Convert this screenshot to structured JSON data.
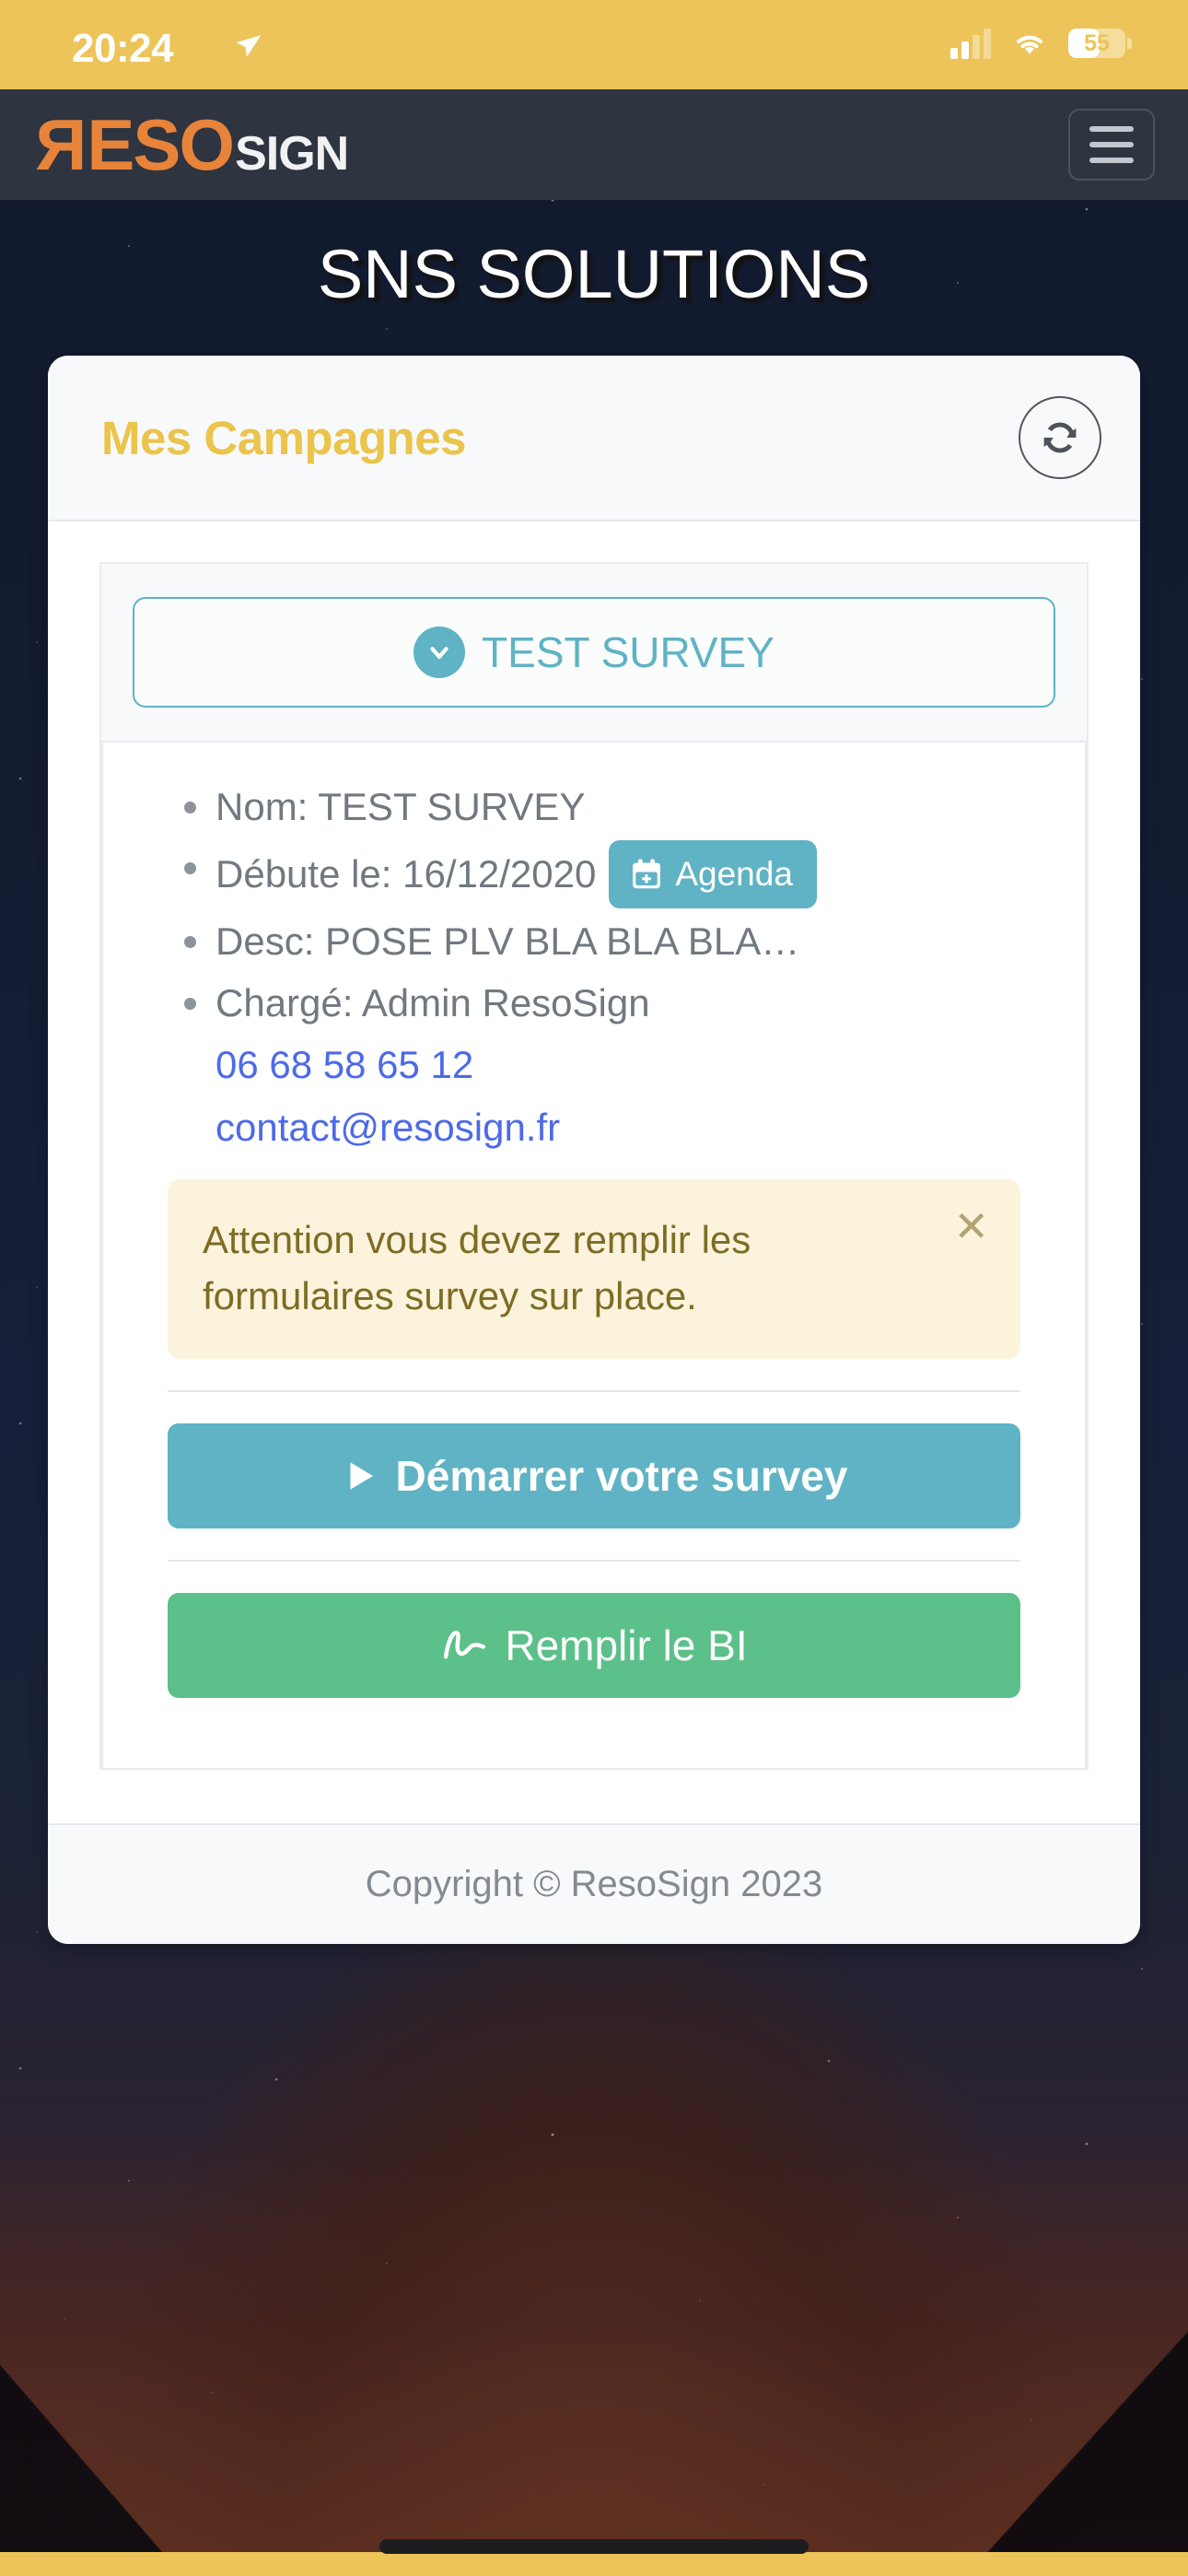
{
  "status_bar": {
    "time": "20:24",
    "battery_percent": "55",
    "battery_level": 55,
    "icons": [
      "location-arrow-icon",
      "cellular-signal-icon",
      "wifi-icon",
      "battery-icon"
    ],
    "background_color": "#ecc459"
  },
  "navbar": {
    "brand_primary": "RESO",
    "brand_secondary": "SIGN",
    "brand_primary_color": "#e8833a",
    "brand_secondary_color": "#f2f2f2",
    "background_color": "#2e3440",
    "menu_icon": "hamburger-menu-icon"
  },
  "page": {
    "title": "SNS SOLUTIONS"
  },
  "card": {
    "header_title": "Mes Campagnes",
    "header_title_color": "#ebc44c",
    "refresh_icon": "refresh-sync-icon",
    "footer_text": "Copyright © ResoSign 2023"
  },
  "accordion": {
    "toggle_label": "TEST SURVEY",
    "toggle_icon": "chevron-down-circle-icon",
    "accent_color": "#5fb3c4",
    "expanded": true
  },
  "details": {
    "nom_label": "Nom:",
    "nom_value": "TEST SURVEY",
    "nom_line": "Nom: TEST SURVEY",
    "debute_line": "Débute le: 16/12/2020",
    "debute_label": "Débute le:",
    "debute_value": "16/12/2020",
    "desc_line": "Desc: POSE PLV BLA BLA BLA…",
    "desc_label": "Desc:",
    "desc_value": "POSE PLV BLA BLA BLA…",
    "charge_line": "Chargé: Admin ResoSign",
    "charge_label": "Chargé:",
    "charge_value": "Admin ResoSign",
    "phone": "06 68 58 65 12",
    "email": "contact@resosign.fr",
    "link_color": "#4c6ae8",
    "agenda_button_label": "Agenda",
    "agenda_icon": "calendar-plus-icon"
  },
  "alert": {
    "message": "Attention vous devez remplir les formulaires survey sur place.",
    "close_icon": "close-x-icon",
    "background_color": "#fbf3dc",
    "text_color": "#7d6c24"
  },
  "actions": {
    "start_survey_label": "Démarrer votre survey",
    "start_survey_icon": "play-icon",
    "start_survey_color": "#5fb3c4",
    "fill_bi_label": "Remplir le BI",
    "fill_bi_icon": "signature-icon",
    "fill_bi_color": "#5cc08a"
  }
}
